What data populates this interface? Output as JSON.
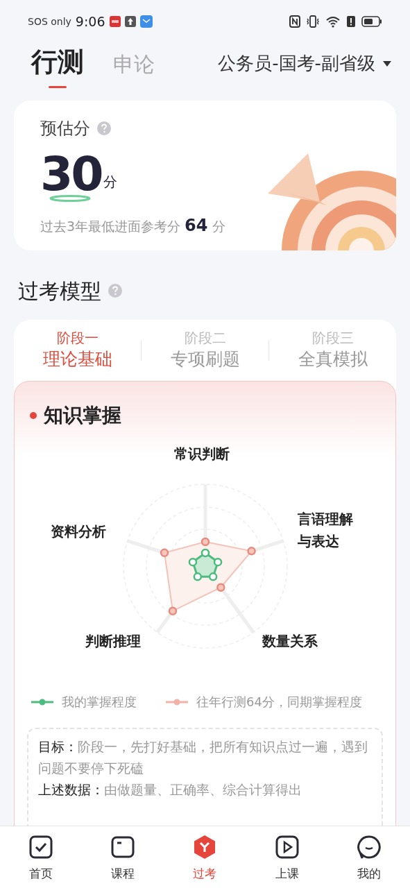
{
  "status_bar": {
    "carrier": "SOS only",
    "time": "9:06"
  },
  "subject_tabs": [
    {
      "label": "行测",
      "selected": true
    },
    {
      "label": "申论",
      "selected": false
    }
  ],
  "exam_selector": {
    "label": "公务员-国考-副省级"
  },
  "score_card": {
    "title": "预估分",
    "score": "30",
    "score_unit": "分",
    "reference_prefix": "过去3年最低进面参考分",
    "reference_score": "64",
    "reference_unit": "分"
  },
  "model_section": {
    "title": "过考模型"
  },
  "stages": [
    {
      "step": "阶段一",
      "name": "理论基础",
      "selected": true
    },
    {
      "step": "阶段二",
      "name": "专项刷题",
      "selected": false
    },
    {
      "step": "阶段三",
      "name": "全真模拟",
      "selected": false
    }
  ],
  "knowledge": {
    "title": "知识掌握",
    "axes": [
      "常识判断",
      "言语理解与表达",
      "数量关系",
      "判断推理",
      "资料分析"
    ]
  },
  "legend": [
    {
      "label": "我的掌握程度",
      "color": "#4cbb7f"
    },
    {
      "label": "往年行测64分，同期掌握程度",
      "color": "#f2b2a6"
    }
  ],
  "notes": [
    {
      "label": "目标：",
      "text": "阶段一，先打好基础，把所有知识点过一遍，遇到问题不要停下死磕"
    },
    {
      "label": "上述数据：",
      "text": "由做题量、正确率、综合计算得出"
    }
  ],
  "bottom_nav": [
    {
      "label": "首页",
      "kind": "home",
      "selected": false
    },
    {
      "label": "课程",
      "kind": "course",
      "selected": false
    },
    {
      "label": "过考",
      "kind": "pass",
      "selected": true
    },
    {
      "label": "上课",
      "kind": "class",
      "selected": false
    },
    {
      "label": "我的",
      "kind": "me",
      "selected": false
    }
  ]
}
